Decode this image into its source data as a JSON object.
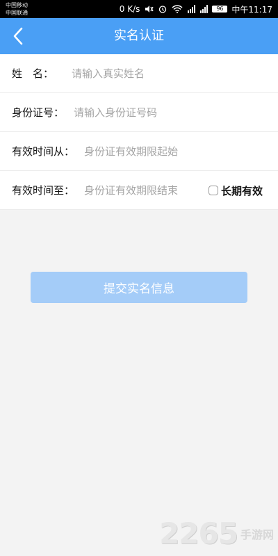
{
  "status_bar": {
    "carrier_1": "中国移动",
    "carrier_2": "中国联通",
    "network_speed": "0 K/s",
    "battery": "96",
    "time": "中午11:17"
  },
  "header": {
    "title": "实名认证"
  },
  "form": {
    "rows": [
      {
        "label": "姓　名：",
        "placeholder": "请输入真实姓名",
        "value": ""
      },
      {
        "label": "身份证号：",
        "placeholder": "请输入身份证号码",
        "value": ""
      },
      {
        "label": "有效时间从：",
        "placeholder": "身份证有效期限起始",
        "value": ""
      },
      {
        "label": "有效时间至：",
        "placeholder": "身份证有效期限结束",
        "value": ""
      }
    ],
    "long_term": {
      "label": "长期有效",
      "checked": false
    }
  },
  "actions": {
    "submit_label": "提交实名信息"
  },
  "watermark": {
    "number": "2265",
    "text": "手游网"
  },
  "colors": {
    "header_bg": "#4a9ff5",
    "button_bg": "#a4ccf8",
    "page_bg": "#f3f3f3"
  },
  "icons": {
    "back": "chevron-left-icon"
  }
}
